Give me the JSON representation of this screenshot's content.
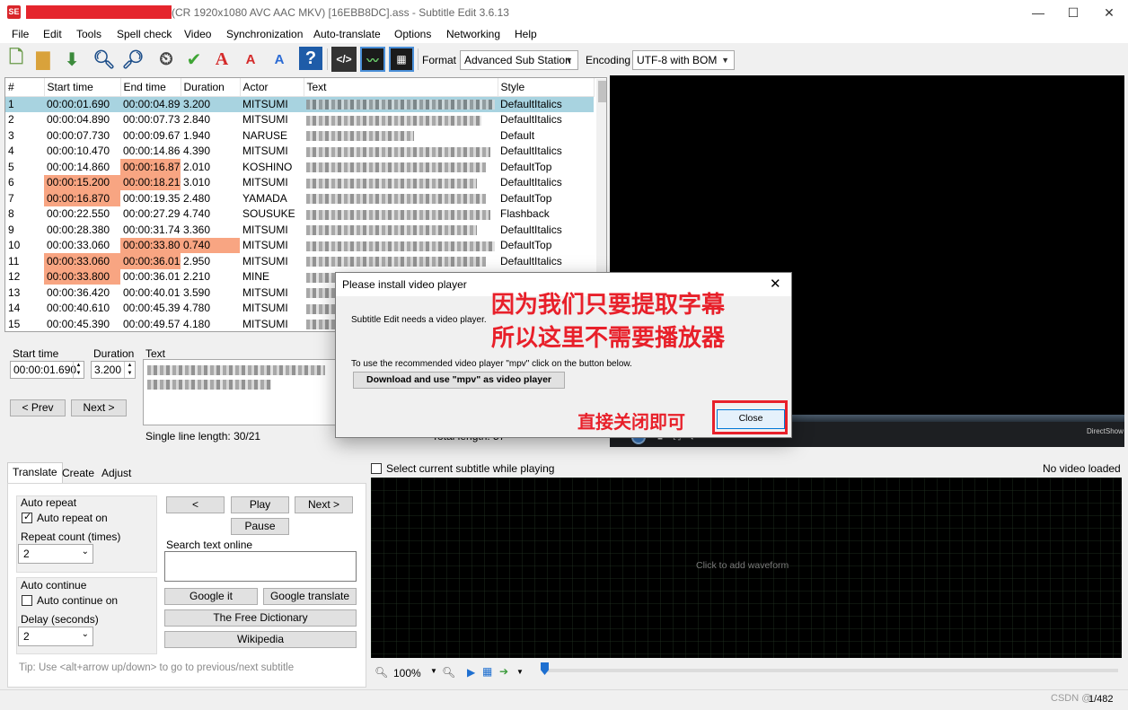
{
  "window": {
    "title_suffix": "(CR 1920x1080 AVC AAC MKV) [16EBB8DC].ass - Subtitle Edit 3.6.13",
    "logo_text": "SE"
  },
  "menu": [
    "File",
    "Edit",
    "Tools",
    "Spell check",
    "Video",
    "Synchronization",
    "Auto-translate",
    "Options",
    "Networking",
    "Help"
  ],
  "toolbar": {
    "format_label": "Format",
    "format_value": "Advanced Sub Station",
    "encoding_label": "Encoding",
    "encoding_value": "UTF-8 with BOM"
  },
  "grid": {
    "columns": [
      "#",
      "Start time",
      "End time",
      "Duration",
      "Actor",
      "Text",
      "Style"
    ],
    "rows": [
      {
        "n": "1",
        "start": "00:00:01.690",
        "end": "00:00:04.890",
        "dur": "3.200",
        "actor": "MITSUMI",
        "style": "DefaultItalics",
        "selected": true
      },
      {
        "n": "2",
        "start": "00:00:04.890",
        "end": "00:00:07.730",
        "dur": "2.840",
        "actor": "MITSUMI",
        "style": "DefaultItalics"
      },
      {
        "n": "3",
        "start": "00:00:07.730",
        "end": "00:00:09.670",
        "dur": "1.940",
        "actor": "NARUSE",
        "style": "Default"
      },
      {
        "n": "4",
        "start": "00:00:10.470",
        "end": "00:00:14.860",
        "dur": "4.390",
        "actor": "MITSUMI",
        "style": "DefaultItalics"
      },
      {
        "n": "5",
        "start": "00:00:14.860",
        "end": "00:00:16.870",
        "dur": "2.010",
        "actor": "KOSHINO",
        "style": "DefaultTop",
        "hl": [
          "end"
        ]
      },
      {
        "n": "6",
        "start": "00:00:15.200",
        "end": "00:00:18.210",
        "dur": "3.010",
        "actor": "MITSUMI",
        "style": "DefaultItalics",
        "hl": [
          "start",
          "end"
        ]
      },
      {
        "n": "7",
        "start": "00:00:16.870",
        "end": "00:00:19.350",
        "dur": "2.480",
        "actor": "YAMADA",
        "style": "DefaultTop",
        "hl": [
          "start"
        ]
      },
      {
        "n": "8",
        "start": "00:00:22.550",
        "end": "00:00:27.290",
        "dur": "4.740",
        "actor": "SOUSUKE",
        "style": "Flashback"
      },
      {
        "n": "9",
        "start": "00:00:28.380",
        "end": "00:00:31.740",
        "dur": "3.360",
        "actor": "MITSUMI",
        "style": "DefaultItalics"
      },
      {
        "n": "10",
        "start": "00:00:33.060",
        "end": "00:00:33.800",
        "dur": "0.740",
        "actor": "MITSUMI",
        "style": "DefaultTop",
        "hl": [
          "end",
          "dur"
        ]
      },
      {
        "n": "11",
        "start": "00:00:33.060",
        "end": "00:00:36.010",
        "dur": "2.950",
        "actor": "MITSUMI",
        "style": "DefaultItalics",
        "hl": [
          "start",
          "end"
        ]
      },
      {
        "n": "12",
        "start": "00:00:33.800",
        "end": "00:00:36.010",
        "dur": "2.210",
        "actor": "MINE",
        "style": "",
        "hl": [
          "start"
        ]
      },
      {
        "n": "13",
        "start": "00:00:36.420",
        "end": "00:00:40.010",
        "dur": "3.590",
        "actor": "MITSUMI",
        "style": ""
      },
      {
        "n": "14",
        "start": "00:00:40.610",
        "end": "00:00:45.390",
        "dur": "4.780",
        "actor": "MITSUMI",
        "style": ""
      },
      {
        "n": "15",
        "start": "00:00:45.390",
        "end": "00:00:49.570",
        "dur": "4.180",
        "actor": "MITSUMI",
        "style": ""
      }
    ]
  },
  "editor": {
    "start_time_label": "Start time",
    "start_time_value": "00:00:01.690",
    "duration_label": "Duration",
    "duration_value": "3.200",
    "text_label": "Text",
    "prev_label": "< Prev",
    "next_label": "Next >",
    "single_line_length": "Single line length: 30/21",
    "total_length": "Total length: 57"
  },
  "tabs": [
    "Translate",
    "Create",
    "Adjust"
  ],
  "translate": {
    "auto_repeat_title": "Auto repeat",
    "auto_repeat_on": "Auto repeat on",
    "repeat_count_label": "Repeat count (times)",
    "repeat_count_value": "2",
    "auto_continue_title": "Auto continue",
    "auto_continue_on": "Auto continue on",
    "delay_label": "Delay (seconds)",
    "delay_value": "2",
    "prev_btn": "<",
    "play_btn": "Play",
    "next_btn": "Next >",
    "pause_btn": "Pause",
    "search_label": "Search text online",
    "google_it": "Google it",
    "google_translate": "Google translate",
    "free_dictionary": "The Free Dictionary",
    "wikipedia": "Wikipedia",
    "tip": "Tip: Use <alt+arrow up/down> to go to previous/next subtitle"
  },
  "waveform": {
    "select_while_playing": "Select current subtitle while playing",
    "no_video": "No video loaded",
    "hint": "Click to add waveform",
    "zoom": "100%"
  },
  "video": {
    "directshow": "DirectShow"
  },
  "status": {
    "position": "1/482",
    "watermark": "CSDN @"
  },
  "dialog": {
    "title": "Please install video player",
    "message1": "Subtitle Edit needs a video player.",
    "message2": "To use the recommended video player \"mpv\" click on the button below.",
    "download_btn": "Download and use \"mpv\" as video player",
    "close_btn": "Close"
  },
  "annotation": {
    "line1": "因为我们只要提取字幕",
    "line2": "所以这里不需要播放器",
    "close_hint": "直接关闭即可",
    "color": "#e8202a"
  }
}
